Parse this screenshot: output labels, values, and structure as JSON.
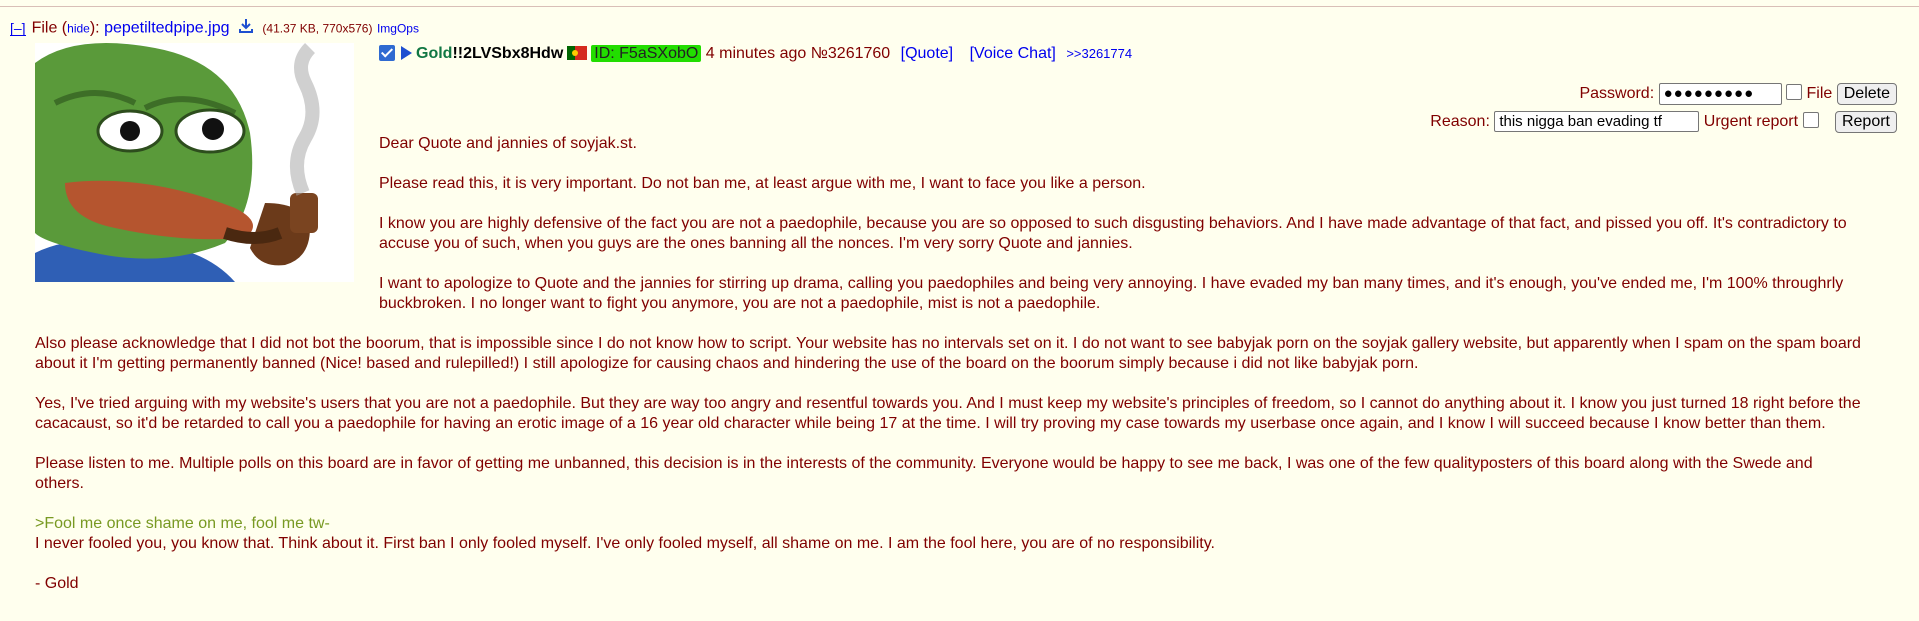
{
  "file": {
    "toggle": "[–]",
    "label": "File (",
    "hide": "hide",
    "close": "):",
    "filename": "pepetiltedpipe.jpg",
    "meta": "(41.37 KB, 770x576)",
    "imgops": "ImgOps"
  },
  "post": {
    "name": "Gold",
    "tripcode": "!!2LVSbx8Hdw",
    "poster_id": "ID: F5aSXobO",
    "time": "4 minutes ago",
    "number": "№3261760",
    "quote_link": "[Quote]",
    "voice_chat": "[Voice Chat]",
    "backlink": ">>3261774"
  },
  "controls": {
    "password_label": "Password:",
    "password_value": "●●●●●●●●●",
    "file_label": "File",
    "delete_button": "Delete",
    "reason_label": "Reason:",
    "reason_value": "this nigga ban evading tf",
    "urgent_label": "Urgent report",
    "report_button": "Report"
  },
  "body": {
    "p1": "Dear Quote and jannies of soyjak.st.",
    "p2": "Please read this, it is very important. Do not ban me, at least argue with me, I want to face you like a person.",
    "p3": "I know you are highly defensive of the fact you are not a paedophile, because you are so opposed to such disgusting behaviors. And I have made advantage of that fact, and pissed you off. It's contradictory to accuse you of such, when you guys are the ones banning all the nonces. I'm very sorry Quote and jannies.",
    "p4": "I want to apologize to Quote and the jannies for stirring up drama, calling you paedophiles and being very annoying. I have evaded my ban many times, and it's enough, you've ended me, I'm 100% throughrly buckbroken. I no longer want to fight you anymore, you are not a paedophile, mist is not a paedophile.",
    "p5": "Also please acknowledge that I did not bot the boorum, that is impossible since I do not know how to script. Your website has no intervals set on it. I do not want to see babyjak porn on the soyjak gallery website, but apparently when I spam on the spam board about it I'm getting permanently banned (Nice! based and rulepilled!) I still apologize for causing chaos and hindering the use of the board on the boorum simply because i did not like babyjak porn.",
    "p6": "Yes, I've tried arguing with my website's users that you are not a paedophile. But they are way too angry and resentful towards you. And I must keep my website's principles of freedom, so I cannot do anything about it. I know you just turned 18 right before the cacacaust, so it'd be retarded to call you a paedophile for having an erotic image of a 16 year old character while being 17 at the time. I will try proving my case towards my userbase once again, and I know I will succeed because I know better than them.",
    "p7": "Please listen to me. Multiple polls on this board are in favor of getting me unbanned, this decision is in the interests of the community. Everyone would be happy to see me back, I was one of the few qualityposters of this board along with the Swede and others.",
    "greentext": ">Fool me once shame on me, fool me tw-",
    "p8": "I never fooled you, you know that. Think about it. First ban I only fooled myself. I've only fooled myself, all shame on me. I am the fool here, you are of no responsibility.",
    "signoff": "- Gold"
  },
  "colors": {
    "background": "#ffffee",
    "text": "#800000",
    "name": "#117743",
    "id_badge": "#22dd00",
    "greentext": "#789922",
    "link": "#0000ee"
  }
}
